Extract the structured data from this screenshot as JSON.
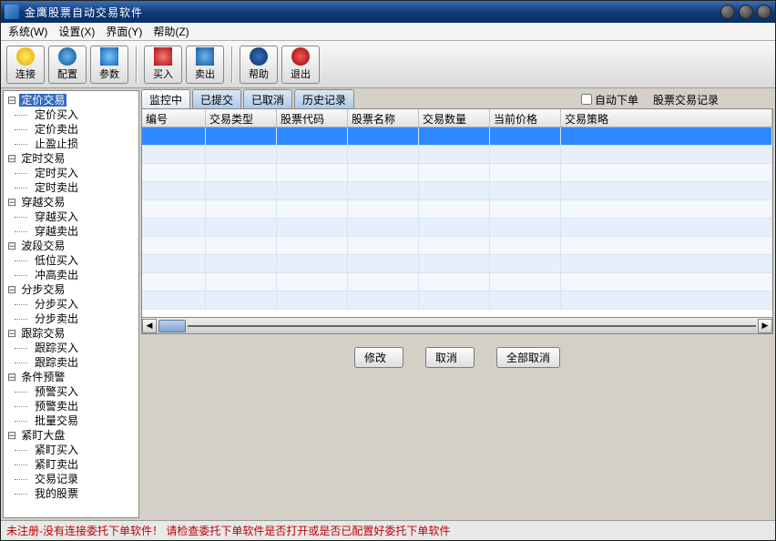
{
  "window": {
    "title": "金鹰股票自动交易软件"
  },
  "menu": {
    "system": "系统(W)",
    "settings": "设置(X)",
    "view": "界面(Y)",
    "help": "帮助(Z)"
  },
  "toolbar": {
    "connect": "连接",
    "config": "配置",
    "param": "参数",
    "buy": "买入",
    "sell": "卖出",
    "thelp": "帮助",
    "exit": "退出"
  },
  "tree": {
    "groups": [
      {
        "label": "定价交易",
        "selected": true,
        "children": [
          "定价买入",
          "定价卖出",
          "止盈止损"
        ]
      },
      {
        "label": "定时交易",
        "children": [
          "定时买入",
          "定时卖出"
        ]
      },
      {
        "label": "穿越交易",
        "children": [
          "穿越买入",
          "穿越卖出"
        ]
      },
      {
        "label": "波段交易",
        "children": [
          "低位买入",
          "冲高卖出"
        ]
      },
      {
        "label": "分步交易",
        "children": [
          "分步买入",
          "分步卖出"
        ]
      },
      {
        "label": "跟踪交易",
        "children": [
          "跟踪买入",
          "跟踪卖出"
        ]
      },
      {
        "label": "条件预警",
        "children": [
          "预警买入",
          "预警卖出",
          "批量交易"
        ]
      },
      {
        "label": "紧盯大盘",
        "children": [
          "紧盯买入",
          "紧盯卖出"
        ]
      }
    ],
    "extras": [
      "交易记录",
      "我的股票"
    ]
  },
  "tabs": {
    "t0": "监控中",
    "t1": "已提交",
    "t2": "已取消",
    "t3": "历史记录"
  },
  "options": {
    "auto_order": "自动下单",
    "trade_log": "股票交易记录"
  },
  "columns": {
    "c0": "编号",
    "c1": "交易类型",
    "c2": "股票代码",
    "c3": "股票名称",
    "c4": "交易数量",
    "c5": "当前价格",
    "c6": "交易策略"
  },
  "buttons": {
    "modify": "修改",
    "cancel": "取消",
    "cancel_all": "全部取消"
  },
  "status": "未注册-没有连接委托下单软件！ 请检查委托下单软件是否打开或是否已配置好委托下单软件"
}
